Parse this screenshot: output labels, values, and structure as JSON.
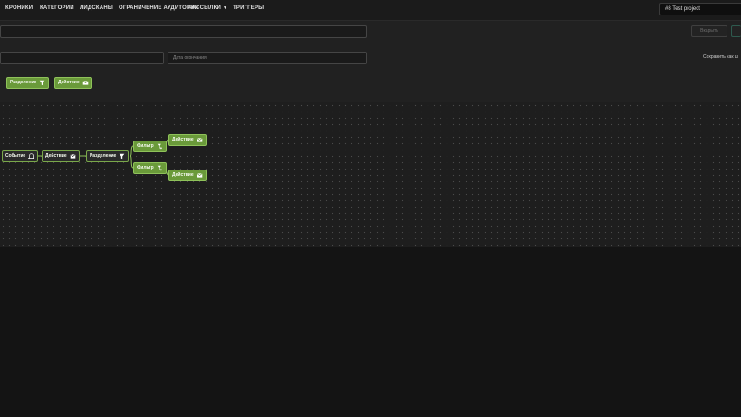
{
  "nav": {
    "items": [
      {
        "label": "КРОНИКИ"
      },
      {
        "label": "КАТЕГОРИИ"
      },
      {
        "label": "ЛИДСКАНЫ"
      },
      {
        "label": "ОГРАНИЧЕНИЕ АУДИТОРИИ"
      },
      {
        "label": "РАССЫЛКИ",
        "has_dropdown": true
      },
      {
        "label": "ТРИГГЕРЫ"
      }
    ],
    "project_select": "#8 Test project"
  },
  "form": {
    "name_input": "",
    "secondary_input": "",
    "description_input": "Дата окончания",
    "disabled_button": "Вкарыть",
    "save_link": "Сохранить как ш"
  },
  "palette": [
    {
      "label": "Разделение",
      "icon": "filter-icon"
    },
    {
      "label": "Действие",
      "icon": "email-icon"
    }
  ],
  "flow": {
    "nodes": [
      {
        "label": "Событие",
        "icon": "bell-icon"
      },
      {
        "label": "Действие",
        "icon": "email-icon"
      },
      {
        "label": "Разделение",
        "icon": "filter-icon"
      },
      {
        "label": "Фильтр",
        "icon": "filter-plus-icon"
      },
      {
        "label": "Действие",
        "icon": "email-icon"
      },
      {
        "label": "Фильтр",
        "icon": "filter-plus-icon"
      },
      {
        "label": "Действие",
        "icon": "email-icon"
      }
    ]
  },
  "colors": {
    "background": "#141414",
    "panel": "#212121",
    "node_fill": "#6a9a3a",
    "node_border": "#8fc25a"
  }
}
